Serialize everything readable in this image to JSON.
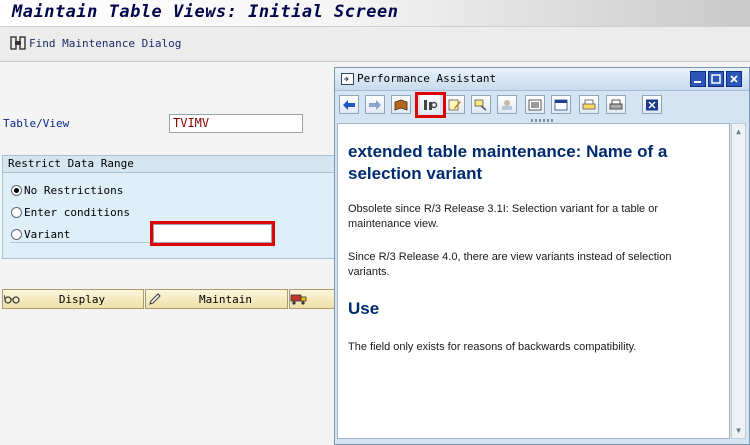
{
  "screen": {
    "title": "Maintain Table Views: Initial Screen",
    "toolbar": {
      "find_label": "Find Maintenance Dialog"
    },
    "table_view": {
      "label": "Table/View",
      "value": "TVIMV"
    },
    "restrict": {
      "header": "Restrict Data Range",
      "options": [
        "No Restrictions",
        "Enter conditions",
        "Variant"
      ],
      "selected": "No Restrictions",
      "variant_value": ""
    },
    "buttons": {
      "display": "Display",
      "maintain": "Maintain"
    }
  },
  "assistant": {
    "title": "Performance Assistant",
    "heading": "extended table maintenance: Name of a selection variant",
    "para1": "Obsolete since R/3 Release 3.1I: Selection variant for a table or maintenance view.",
    "para2": "Since R/3 Release 4.0, there are view variants instead of selection variants.",
    "use_heading": "Use",
    "para3": "The field only exists for reasons of backwards compatibility."
  },
  "colors": {
    "highlight": "#e10000",
    "heading": "#002a6e",
    "sap_blue": "#2c56b8"
  }
}
